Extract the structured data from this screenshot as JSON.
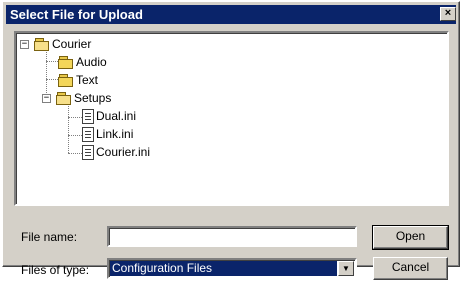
{
  "dialog": {
    "title": "Select File for Upload",
    "close_glyph": "×"
  },
  "tree": {
    "root": {
      "label": "Courier",
      "expander": "−"
    },
    "items": [
      {
        "label": "Audio",
        "icon": "folder-icon"
      },
      {
        "label": "Text",
        "icon": "folder-icon"
      },
      {
        "label": "Setups",
        "icon": "open-folder-icon",
        "expander": "−"
      },
      {
        "label": "Dual.ini",
        "icon": "ini-file-icon"
      },
      {
        "label": "Link.ini",
        "icon": "ini-file-icon"
      },
      {
        "label": "Courier.ini",
        "icon": "ini-file-icon"
      }
    ]
  },
  "form": {
    "file_name_label": "File name:",
    "file_name_value": "",
    "file_type_label": "Files of type:",
    "file_type_value": "Configuration Files",
    "dropdown_glyph": "▼"
  },
  "buttons": {
    "open": "Open",
    "cancel": "Cancel"
  },
  "colors": {
    "titlebar": "#0a246a",
    "face": "#d4d0c8",
    "selection": "#0a246a"
  }
}
